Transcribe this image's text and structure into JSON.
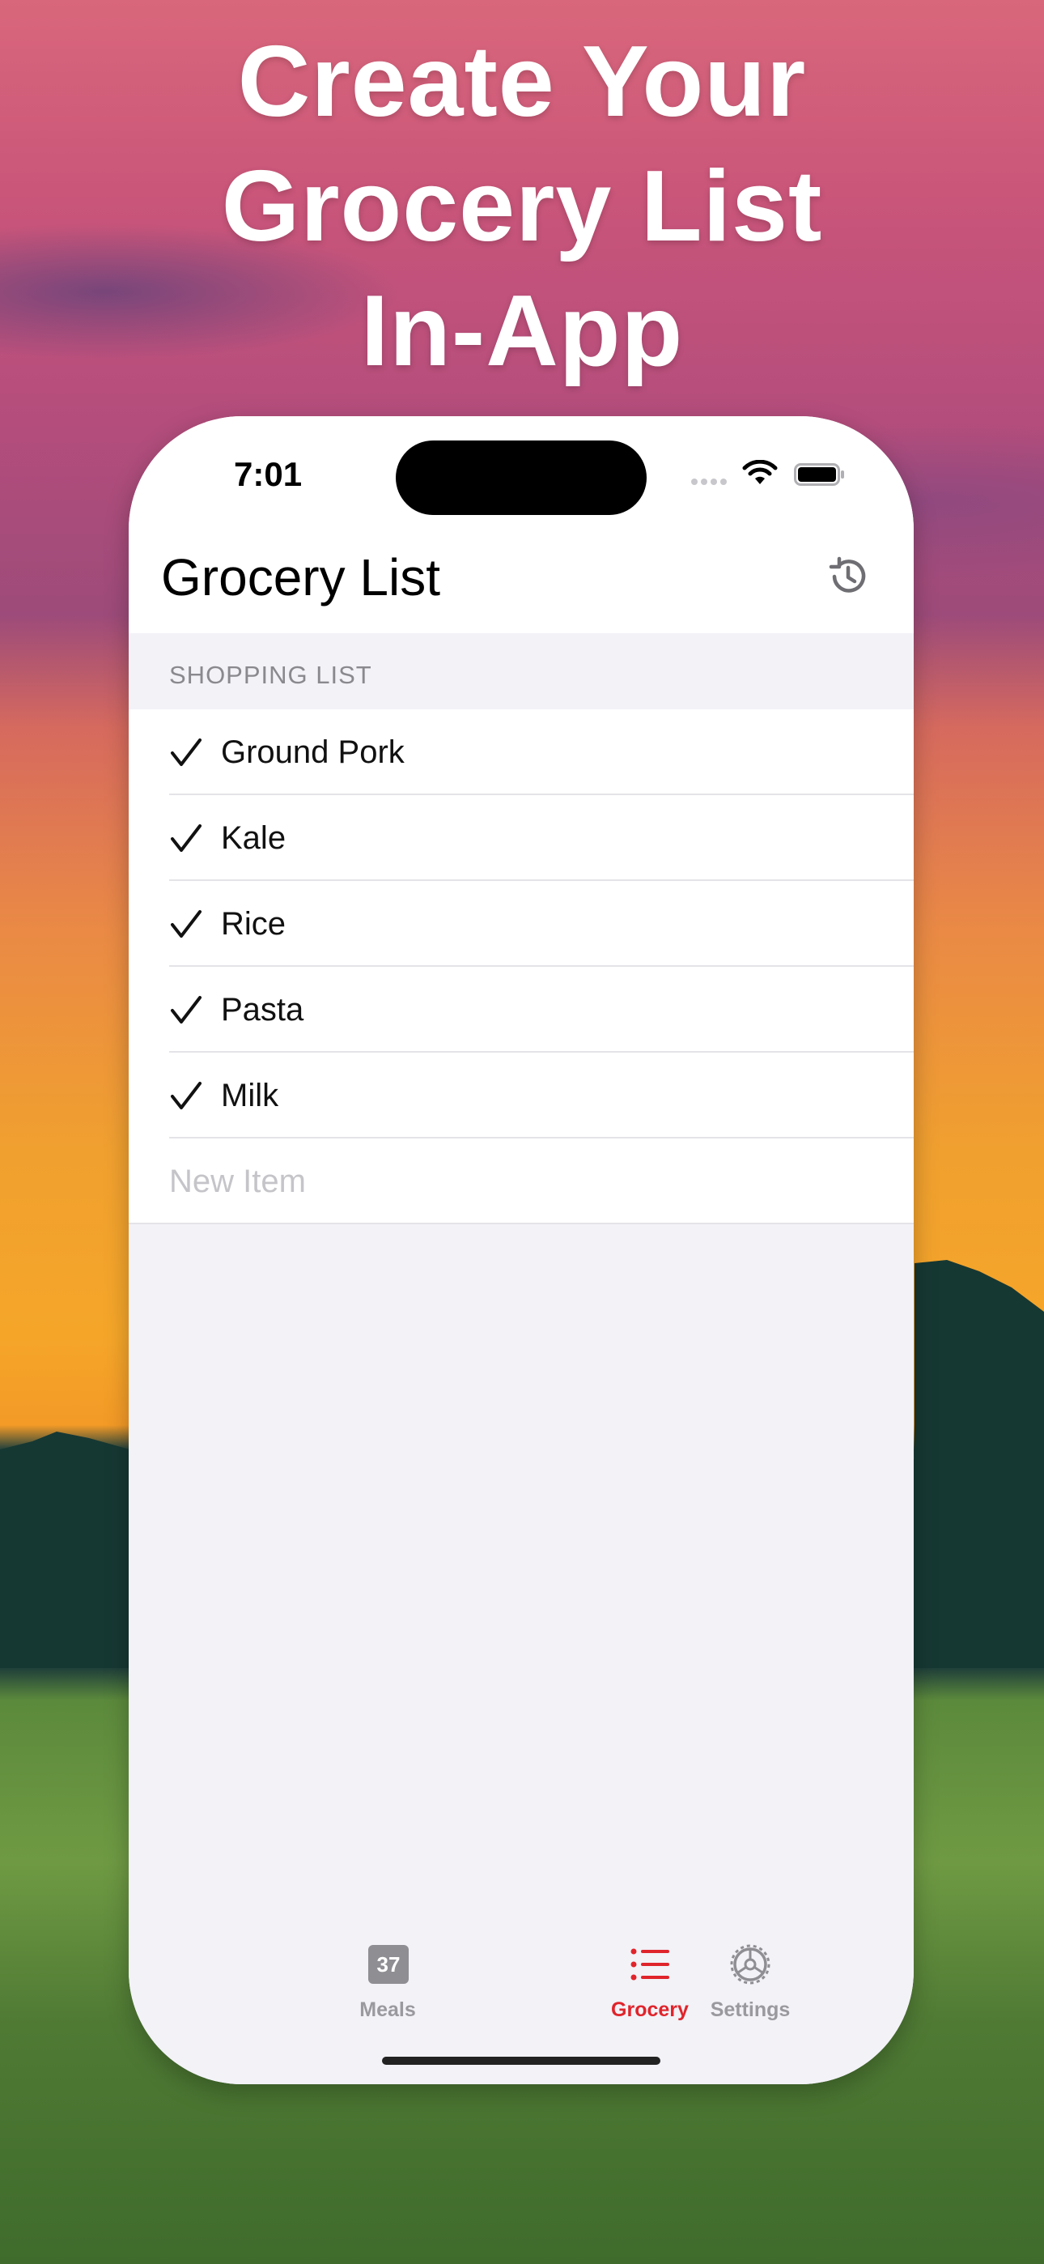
{
  "headline": [
    "Create Your",
    "Grocery List",
    "In-App"
  ],
  "status_bar": {
    "time": "7:01"
  },
  "nav": {
    "title": "Grocery List",
    "history_icon": "clock-arrow-history-icon"
  },
  "section_header": "SHOPPING LIST",
  "items": [
    {
      "label": "Ground Pork",
      "checked": true
    },
    {
      "label": "Kale",
      "checked": true
    },
    {
      "label": "Rice",
      "checked": true
    },
    {
      "label": "Pasta",
      "checked": true
    },
    {
      "label": "Milk",
      "checked": true
    }
  ],
  "new_item": {
    "placeholder": "New Item",
    "value": ""
  },
  "tabs": [
    {
      "label": "Meals",
      "icon": "calendar-icon",
      "icon_text": "37",
      "active": false
    },
    {
      "label": "Grocery",
      "icon": "list-icon",
      "active": true
    },
    {
      "label": "Settings",
      "icon": "gear-icon",
      "active": false
    }
  ],
  "colors": {
    "accent": "#e0242b",
    "inactive": "#9a9a9e",
    "background": "#f2f2f7"
  }
}
